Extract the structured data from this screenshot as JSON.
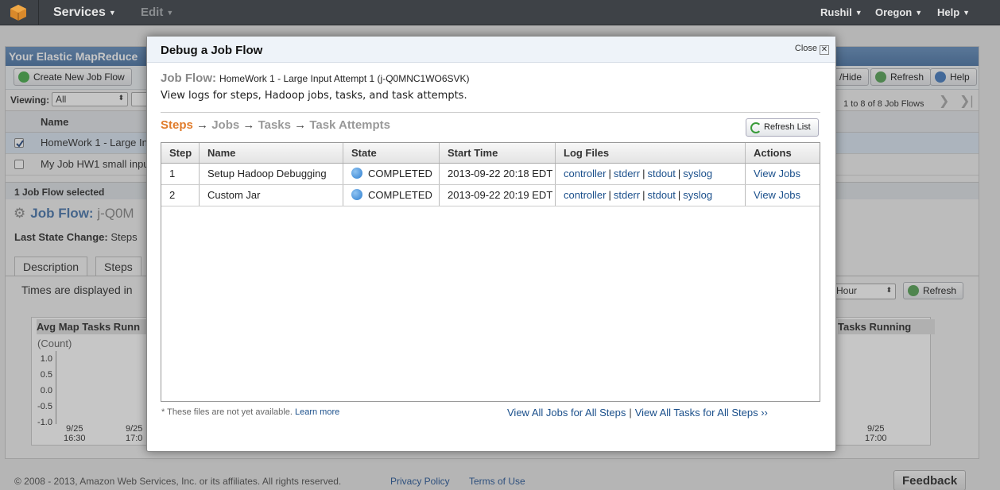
{
  "topbar": {
    "services": "Services",
    "edit": "Edit",
    "user": "Rushil",
    "region": "Oregon",
    "help": "Help"
  },
  "background": {
    "header": "Your Elastic MapReduce",
    "create_button": "Create New Job Flow",
    "show_hide": "/Hide",
    "refresh": "Refresh",
    "help": "Help",
    "viewing_label": "Viewing:",
    "viewing_value": "All",
    "pagination": "1 to 8 of 8 Job Flows",
    "column_name": "Name",
    "rows": [
      "HomeWork 1 - Large In",
      "My Job HW1 small inpu"
    ],
    "selected_count": "1 Job Flow selected",
    "job_flow_label": "Job Flow:",
    "job_flow_id": "j-Q0M",
    "last_state_change": "Last State Change:",
    "last_state_value": "Steps",
    "tabs": [
      "Description",
      "Steps"
    ],
    "times_note": "Times are displayed in",
    "period_value": "Hour",
    "refresh2": "Refresh",
    "chart_left_title": "Avg Map Tasks Runn",
    "chart_left_unit": "(Count)",
    "chart_left_yticks": [
      "1.0",
      "0.5",
      "0.0",
      "-0.5",
      "-1.0"
    ],
    "chart_left_xticks": [
      "9/25\n16:30",
      "9/25\n17:0"
    ],
    "chart_right_title": "Tasks Running",
    "chart_right_xtick": "9/25\n17:00"
  },
  "footer": {
    "copyright": "© 2008 - 2013, Amazon Web Services, Inc. or its affiliates. All rights reserved.",
    "privacy": "Privacy Policy",
    "terms": "Terms of Use",
    "feedback": "Feedback"
  },
  "modal": {
    "title": "Debug a Job Flow",
    "close": "Close",
    "job_flow_label": "Job Flow:",
    "job_flow_value": "HomeWork 1 - Large Input Attempt 1 (j-Q0MNC1WO6SVK)",
    "description": "View logs for steps, Hadoop jobs, tasks, and task attempts.",
    "breadcrumb": [
      "Steps",
      "Jobs",
      "Tasks",
      "Task Attempts"
    ],
    "breadcrumb_arrow": "→",
    "refresh_list": "Refresh List",
    "columns": [
      "Step",
      "Name",
      "State",
      "Start Time",
      "Log Files",
      "Actions"
    ],
    "rows": [
      {
        "step": "1",
        "name": "Setup Hadoop Debugging",
        "state": "COMPLETED",
        "start": "2013-09-22 20:18 EDT",
        "logs": [
          "controller",
          "stderr",
          "stdout",
          "syslog"
        ],
        "action": "View Jobs"
      },
      {
        "step": "2",
        "name": "Custom Jar",
        "state": "COMPLETED",
        "start": "2013-09-22 20:19 EDT",
        "logs": [
          "controller",
          "stderr",
          "stdout",
          "syslog"
        ],
        "action": "View Jobs"
      }
    ],
    "note": "* These files are not yet available.",
    "learn_more": "Learn more",
    "view_all_jobs": "View All Jobs for All Steps",
    "separator": "|",
    "view_all_tasks": "View All Tasks for All Steps ››"
  },
  "colors": {
    "topbar": "#3e4247",
    "breadcrumb_active": "#e07b2a",
    "link": "#1a4f8b",
    "status_dot": "#2e7fd0"
  }
}
